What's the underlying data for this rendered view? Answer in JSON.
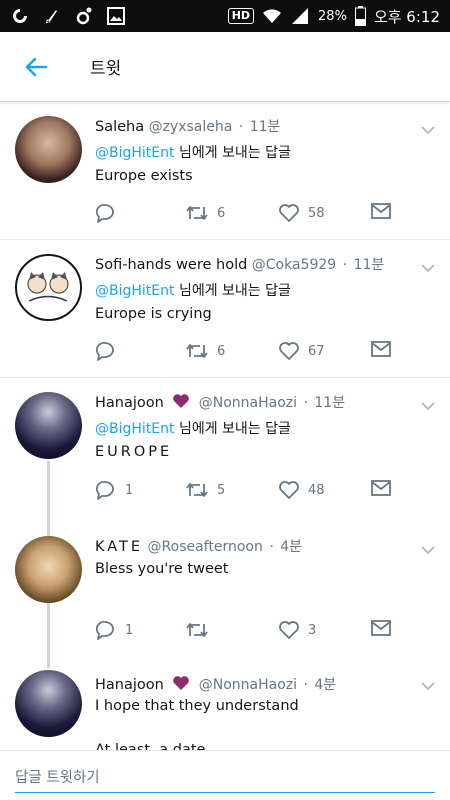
{
  "status_bar": {
    "left_icons": [
      "carrier-icon",
      "bluetooth-icon",
      "music-icon",
      "gallery-icon"
    ],
    "hd": "HD",
    "battery": "28%",
    "time": "오후 6:12"
  },
  "app_bar": {
    "title": "트윗",
    "accent": "#1da1f2"
  },
  "reply_label": "님에게 보내는 답글",
  "tweets": [
    {
      "name": "Saleha",
      "handle": "@zyxsaleha",
      "time": "11분",
      "mention": "@BigHitEnt",
      "text": "Europe exists",
      "replies": "",
      "retweets": "6",
      "likes": "58"
    },
    {
      "name": "Sofi-hands were hold",
      "handle": "@Coka5929",
      "time": "11분",
      "mention": "@BigHitEnt",
      "text": "Europe is crying",
      "replies": "",
      "retweets": "6",
      "likes": "67"
    },
    {
      "name": "Hanajoon",
      "handle": "@NonnaHaozi",
      "time": "11분",
      "mention": "@BigHitEnt",
      "text": "EUROPE",
      "replies": "1",
      "retweets": "5",
      "likes": "48"
    },
    {
      "name": "KATE",
      "handle": "@Roseafternoon",
      "time": "4분",
      "text": "Bless you're tweet",
      "replies": "1",
      "retweets": "",
      "likes": "3"
    },
    {
      "name": "Hanajoon",
      "handle": "@NonnaHaozi",
      "time": "4분",
      "text": "I hope that they understand",
      "text2": "At least ,a date"
    }
  ],
  "composer": {
    "placeholder": "답글 트윗하기"
  }
}
